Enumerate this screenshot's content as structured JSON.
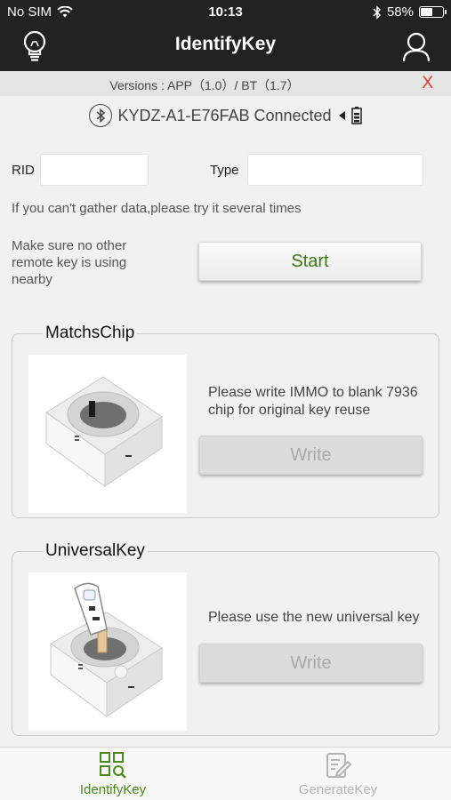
{
  "status_bar": {
    "carrier": "No SIM",
    "time": "10:13",
    "battery_percent": "58%",
    "battery_level": 0.58
  },
  "nav": {
    "title": "IdentifyKey",
    "left_icon": "bulb-icon",
    "right_icon": "user-icon"
  },
  "version_bar": {
    "text": "Versions : APP（1.0）/ BT（1.7）",
    "close_label": "X",
    "close_color": "#e53a2f"
  },
  "device": {
    "name": "KYDZ-A1-E76FAB Connected",
    "icons": [
      "bluetooth-icon",
      "speaker-icon",
      "battery-icon"
    ]
  },
  "form": {
    "rid_label": "RID",
    "rid_value": "",
    "type_label": "Type",
    "type_value": "",
    "tip": "If you can't gather data,please try it several times",
    "note": "Make sure no other\nremote key is using\nnearby",
    "start_label": "Start"
  },
  "panels": {
    "matchs_chip": {
      "title": "MatchsChip",
      "description": "Please write IMMO to blank 7936\nchip for original key reuse",
      "button_label": "Write"
    },
    "universal_key": {
      "title": "UniversalKey",
      "description": "Please use the new universal key",
      "button_label": "Write"
    }
  },
  "tabbar": {
    "tabs": [
      {
        "label": "IdentifyKey",
        "active": true,
        "icon": "grid-search-icon"
      },
      {
        "label": "GenerateKey",
        "active": false,
        "icon": "edit-document-icon"
      }
    ]
  },
  "colors": {
    "accent_green": "#4a8a1a",
    "start_text": "#3b7a12",
    "header_bg": "#222222",
    "close_red": "#e53a2f"
  }
}
